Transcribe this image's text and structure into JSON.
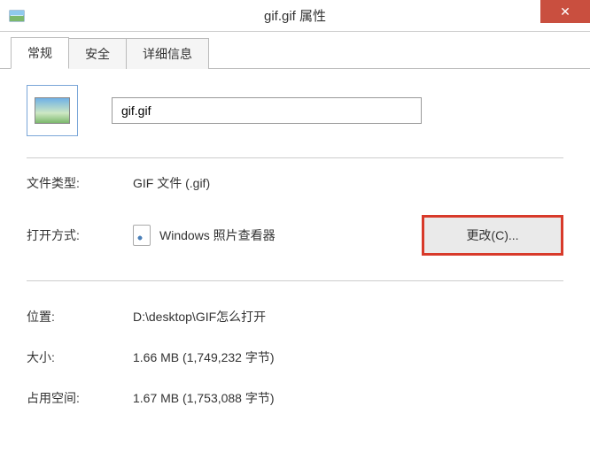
{
  "titlebar": {
    "title": "gif.gif 属性",
    "close_glyph": "✕"
  },
  "tabs": {
    "general": "常规",
    "security": "安全",
    "details": "详细信息"
  },
  "file": {
    "name": "gif.gif"
  },
  "labels": {
    "file_type": "文件类型:",
    "open_with": "打开方式:",
    "location": "位置:",
    "size": "大小:",
    "size_on_disk": "占用空间:"
  },
  "values": {
    "file_type": "GIF 文件 (.gif)",
    "open_with": "Windows 照片查看器",
    "location": "D:\\desktop\\GIF怎么打开",
    "size": "1.66 MB (1,749,232 字节)",
    "size_on_disk": "1.67 MB (1,753,088 字节)"
  },
  "buttons": {
    "change": "更改(C)..."
  }
}
